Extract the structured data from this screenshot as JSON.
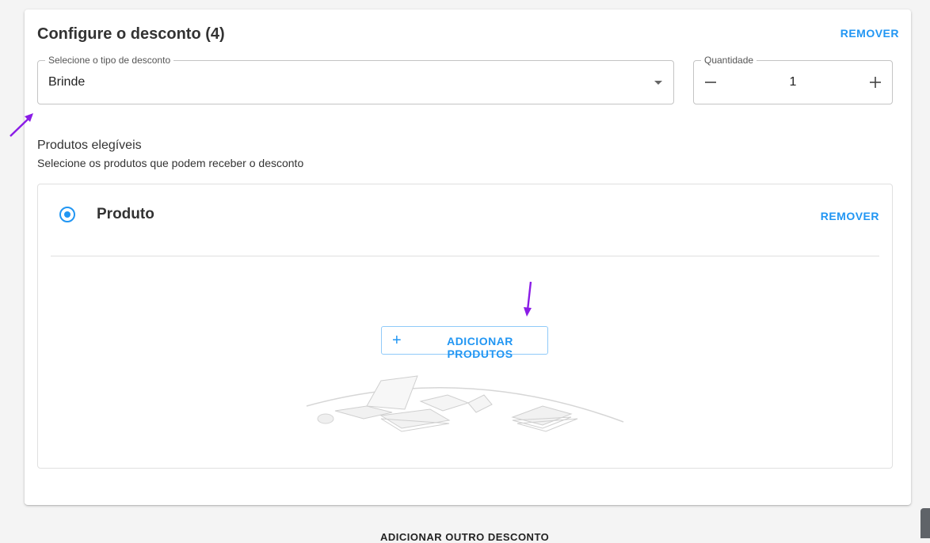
{
  "discount": {
    "title": "Configure o desconto (4)",
    "remove_label": "REMOVER",
    "type_field": {
      "label": "Selecione o tipo de desconto",
      "value": "Brinde"
    },
    "quantity": {
      "label": "Quantidade",
      "value": "1",
      "minus_icon": "minus-icon",
      "plus_icon": "plus-icon"
    }
  },
  "eligible": {
    "title": "Produtos elegíveis",
    "subtitle": "Selecione os produtos que podem receber o desconto"
  },
  "product": {
    "title": "Produto",
    "remove_label": "REMOVER",
    "add_label": "ADICIONAR PRODUTOS",
    "add_icon": "plus-icon",
    "selected": true
  },
  "footer": {
    "add_another_label": "ADICIONAR OUTRO DESCONTO"
  },
  "colors": {
    "accent": "#2196f3",
    "annotation_arrow": "#8a1ce6"
  }
}
